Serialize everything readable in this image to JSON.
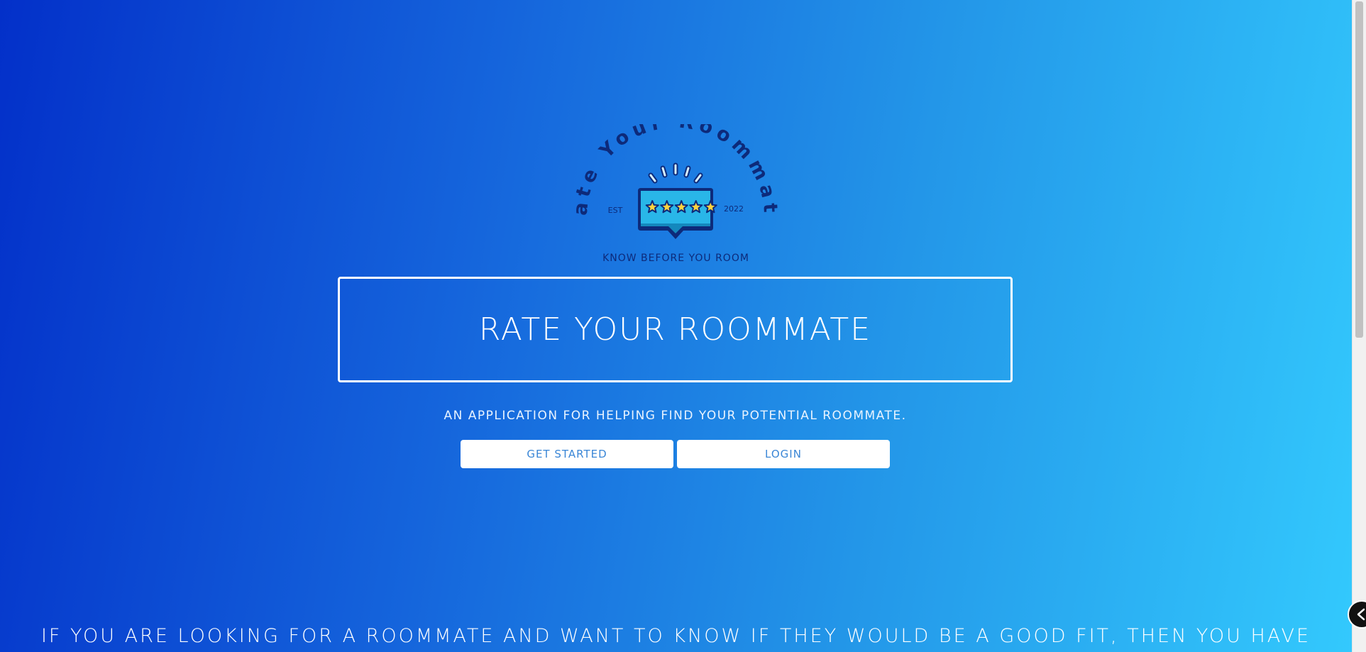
{
  "logo": {
    "arc_text": "Rate Your Roommate",
    "est_label": "EST",
    "year_label": "2022",
    "tagline": "KNOW BEFORE YOU ROOM",
    "stars": 5
  },
  "hero": {
    "title": "RATE YOUR ROOMMATE",
    "subtitle": "AN APPLICATION FOR HELPING FIND YOUR POTENTIAL ROOMMATE."
  },
  "actions": {
    "get_started_label": "GET STARTED",
    "login_label": "LOGIN"
  },
  "intro": {
    "text": "IF YOU ARE LOOKING FOR A ROOMMATE AND WANT TO KNOW IF THEY WOULD BE A GOOD FIT, THEN YOU HAVE COME TO THE RIGHT PLACE!"
  },
  "icons": {
    "back": "chevron-left-icon",
    "rating": "star-icon"
  },
  "colors": {
    "gradient_start": "#0330c9",
    "gradient_end": "#33c9fd",
    "logo_text": "#0d2a7a",
    "bubble": "#29b6e8",
    "star": "#ffd23f",
    "button_text": "#3a86d6"
  }
}
